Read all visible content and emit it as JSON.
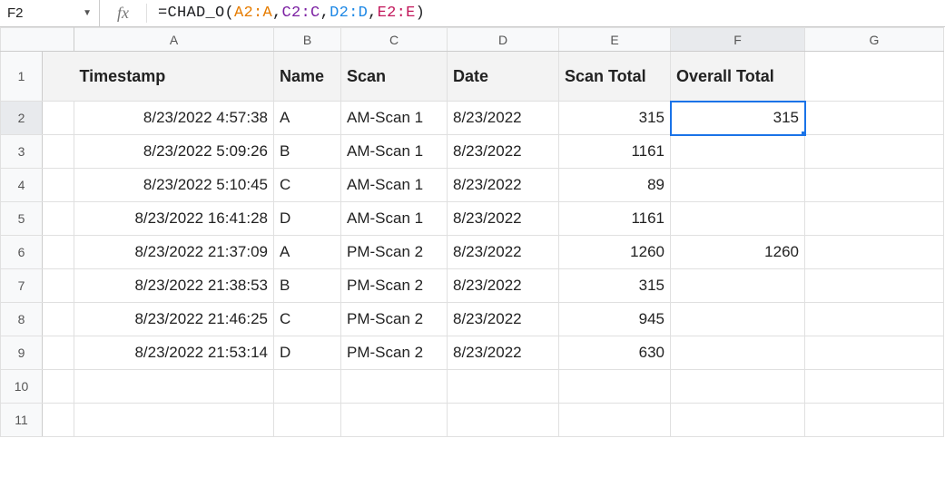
{
  "name_box": "F2",
  "formula_parts": {
    "prefix": "=CHAD_O(",
    "arg1": "A2:A",
    "arg2": "C2:C",
    "arg3": "D2:D",
    "arg4": "E2:E",
    "sep": ",",
    "suffix": ")"
  },
  "col_headers": [
    "A",
    "B",
    "C",
    "D",
    "E",
    "F",
    "G"
  ],
  "row_headers": [
    "1",
    "2",
    "3",
    "4",
    "5",
    "6",
    "7",
    "8",
    "9",
    "10",
    "11"
  ],
  "headers": {
    "a": "Timestamp",
    "b": "Name",
    "c": "Scan",
    "d": "Date",
    "e": "Scan Total",
    "f": "Overall Total"
  },
  "chart_data": {
    "type": "table",
    "columns": [
      "Timestamp",
      "Name",
      "Scan",
      "Date",
      "Scan Total",
      "Overall Total"
    ],
    "rows": [
      [
        "8/23/2022 4:57:38",
        "A",
        "AM-Scan 1",
        "8/23/2022",
        315,
        315
      ],
      [
        "8/23/2022 5:09:26",
        "B",
        "AM-Scan 1",
        "8/23/2022",
        1161,
        null
      ],
      [
        "8/23/2022 5:10:45",
        "C",
        "AM-Scan 1",
        "8/23/2022",
        89,
        null
      ],
      [
        "8/23/2022 16:41:28",
        "D",
        "AM-Scan 1",
        "8/23/2022",
        1161,
        null
      ],
      [
        "8/23/2022 21:37:09",
        "A",
        "PM-Scan 2",
        "8/23/2022",
        1260,
        1260
      ],
      [
        "8/23/2022 21:38:53",
        "B",
        "PM-Scan 2",
        "8/23/2022",
        315,
        null
      ],
      [
        "8/23/2022 21:46:25",
        "C",
        "PM-Scan 2",
        "8/23/2022",
        945,
        null
      ],
      [
        "8/23/2022 21:53:14",
        "D",
        "PM-Scan 2",
        "8/23/2022",
        630,
        null
      ]
    ]
  },
  "selected": {
    "row": 2,
    "col": "F"
  }
}
